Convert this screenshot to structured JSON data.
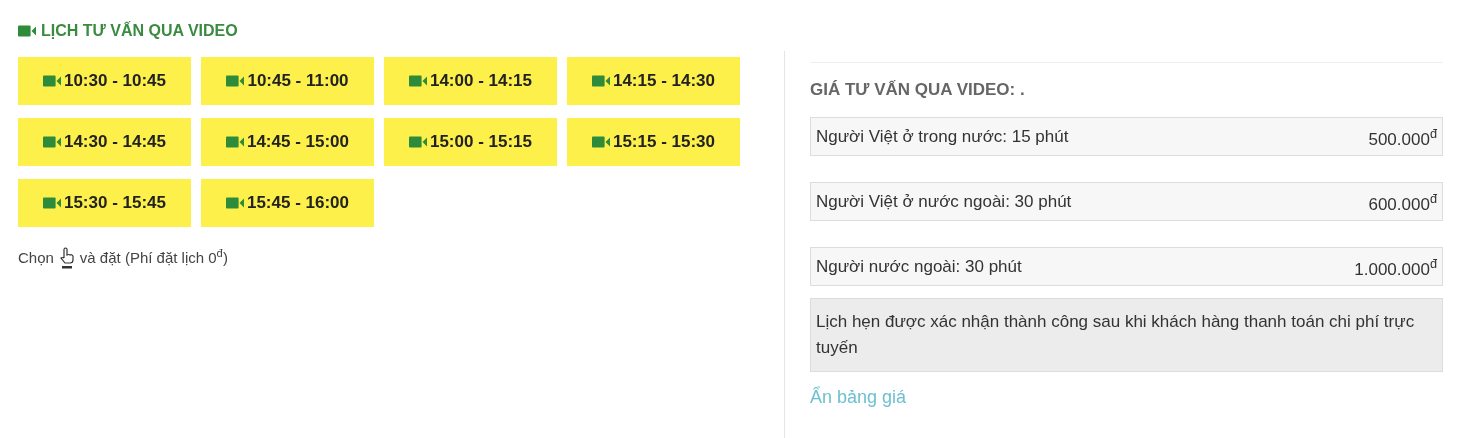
{
  "heading": "LỊCH TƯ VẤN QUA VIDEO",
  "slots": [
    "10:30 - 10:45",
    "10:45 - 11:00",
    "14:00 - 14:15",
    "14:15 - 14:30",
    "14:30 - 14:45",
    "14:45 - 15:00",
    "15:00 - 15:15",
    "15:15 - 15:30",
    "15:30 - 15:45",
    "15:45 - 16:00"
  ],
  "hint": {
    "before": "Chọn",
    "after": "và đặt (Phí đặt lịch 0$^{đ}$)"
  },
  "prices": {
    "title": "GIÁ TƯ VẤN QUA VIDEO: .",
    "rows": [
      {
        "label": "Người Việt ở trong nước: 15 phút",
        "price": "500.000$^{đ}$"
      },
      {
        "label": "Người Việt ở nước ngoài: 30 phút",
        "price": "600.000$^{đ}$"
      },
      {
        "label": "Người nước ngoài: 30 phút",
        "price": "1.000.000$^{đ}$"
      }
    ],
    "note": "Lịch hẹn được xác nhận thành công sau khi khách hàng thanh toán chi phí trực tuyến",
    "toggle": "Ẩn bảng giá"
  }
}
